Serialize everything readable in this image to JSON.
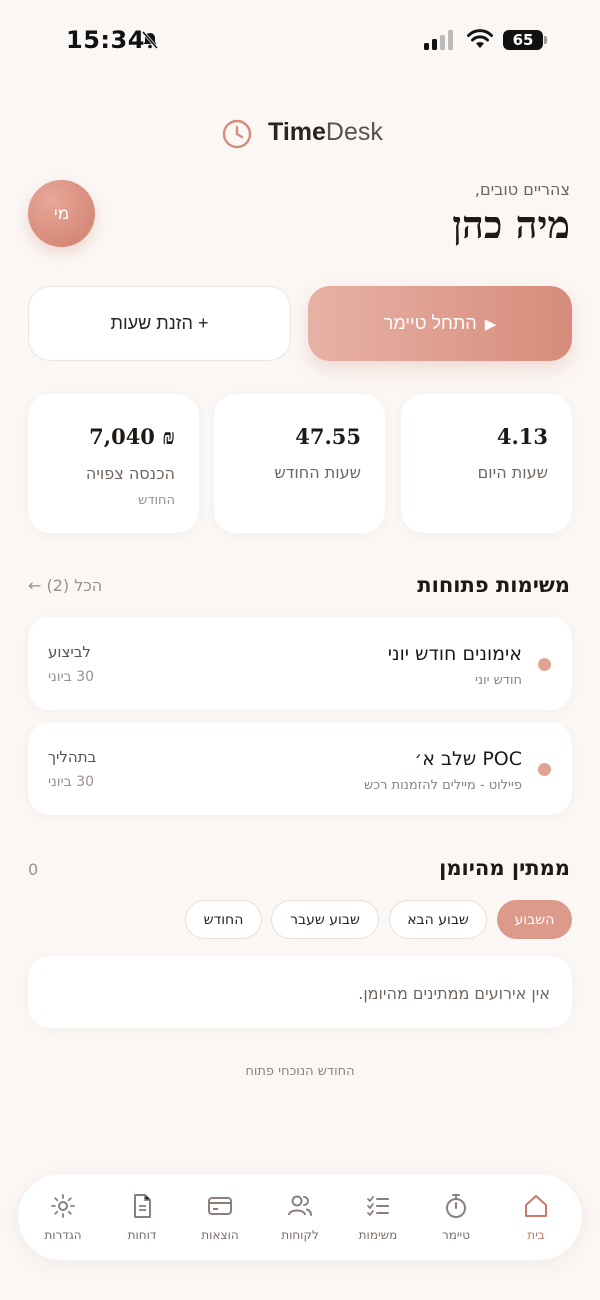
{
  "status_bar": {
    "time": "15:34",
    "battery": "65"
  },
  "app": {
    "name_bold": "Time",
    "name_light": "Desk"
  },
  "header": {
    "greeting": "צהריים טובים,",
    "user_name": "מיה כהן",
    "avatar_initials": "מי"
  },
  "actions": {
    "start_timer": "התחל טיימר",
    "start_timer_icon": "▶",
    "add_hours": "+ הזנת שעות"
  },
  "stats": [
    {
      "value": "4.13",
      "label": "שעות היום",
      "sub": ""
    },
    {
      "value": "47.55",
      "label": "שעות החודש",
      "sub": ""
    },
    {
      "value": "₪ 7,040",
      "label": "הכנסה צפויה",
      "sub": "החודש"
    }
  ],
  "open_tasks": {
    "title": "משימות פתוחות",
    "link": "הכל (2) ←",
    "items": [
      {
        "title": "אימונים חודש יוני",
        "subtitle": "חודש יוני",
        "status": "לביצוע",
        "due": "30 ביוני"
      },
      {
        "title": "POC שלב א׳",
        "subtitle": "פיילוט - מיילים להזמנות רכש",
        "status": "בתהליך",
        "due": "30 ביוני"
      }
    ]
  },
  "calendar": {
    "title": "ממתין מהיומן",
    "count": "0",
    "chips": [
      "השבוע",
      "שבוע הבא",
      "שבוע שעבר",
      "החודש"
    ],
    "active_chip": "השבוע",
    "empty_message": "אין אירועים ממתינים מהיומן."
  },
  "footer_note": "החודש הנוכחי פתוח",
  "nav": [
    {
      "label": "בית",
      "icon": "home-icon",
      "active": true
    },
    {
      "label": "טיימר",
      "icon": "stopwatch-icon",
      "active": false
    },
    {
      "label": "משימות",
      "icon": "checklist-icon",
      "active": false
    },
    {
      "label": "לקוחות",
      "icon": "users-icon",
      "active": false
    },
    {
      "label": "הוצאות",
      "icon": "credit-card-icon",
      "active": false
    },
    {
      "label": "דוחות",
      "icon": "document-icon",
      "active": false
    },
    {
      "label": "הגדרות",
      "icon": "sun-gear-icon",
      "active": false
    }
  ],
  "colors": {
    "accent": "#dc9a8a",
    "background": "#fbf7f5"
  }
}
